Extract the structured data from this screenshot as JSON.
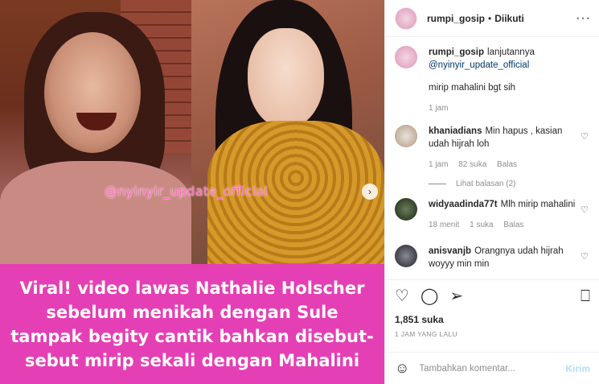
{
  "media": {
    "watermark": "@nyinyir_update_official",
    "caption": "Viral! video lawas Nathalie Holscher sebelum menikah dengan Sule tampak begity cantik bahkan disebut-sebut mirip sekali dengan Mahalini",
    "next_glyph": "›"
  },
  "header": {
    "username": "rumpi_gosip",
    "dot": "•",
    "follow_label": "Diikuti",
    "more_glyph": "···"
  },
  "comments": [
    {
      "user": "rumpi_gosip",
      "text_prefix": "lanjutannya",
      "mention": "@nyinyir_update_official",
      "text2": "mirip mahalini bgt sih",
      "time": "1 jam"
    },
    {
      "user": "khaniadians",
      "text": "Min hapus , kasian udah hijrah loh",
      "time": "1 jam",
      "likes": "82 suka",
      "reply": "Balas",
      "view_replies": "Lihat balasan (2)"
    },
    {
      "user": "widyaadinda77t",
      "text": "Mlh mirip mahalini",
      "time": "18 menit",
      "likes": "1 suka",
      "reply": "Balas"
    },
    {
      "user": "anisvanjb",
      "text": "Orangnya udah hijrah woyyy min min"
    }
  ],
  "actions": {
    "like_glyph": "♡",
    "comment_glyph": "◯",
    "share_glyph": "➢",
    "save_glyph": "⎕"
  },
  "likes": "1,851 suka",
  "time_ago": "1 JAM YANG LALU",
  "composer": {
    "emoji_glyph": "☺",
    "placeholder": "Tambahkan komentar...",
    "post_label": "Kirim"
  }
}
